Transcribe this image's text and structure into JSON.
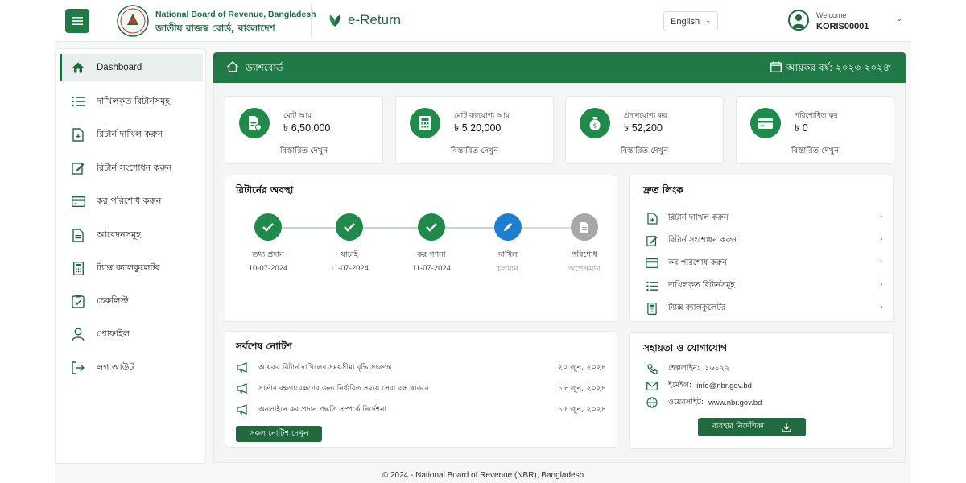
{
  "header": {
    "org_en": "National Board of Revenue, Bangladesh",
    "org_bn": "জাতীয় রাজস্ব বোর্ড, বাংলাদেশ",
    "app_title": "e-Return",
    "language": "English",
    "welcome": "Welcome",
    "username": "KORIS00001"
  },
  "sidebar": {
    "items": [
      {
        "label": "Dashboard",
        "icon": "home-icon"
      },
      {
        "label": "দাখিলকৃত রিটার্নসমূহ",
        "icon": "list-icon"
      },
      {
        "label": "রিটার্ন দাখিল করুন",
        "icon": "file-plus-icon"
      },
      {
        "label": "রিটার্ন সংশোধন করুন",
        "icon": "edit-icon"
      },
      {
        "label": "কর পরিশোধ করুন",
        "icon": "card-icon"
      },
      {
        "label": "আবেদনসমূহ",
        "icon": "document-icon"
      },
      {
        "label": "ট্যাক্স ক্যালকুলেটর",
        "icon": "calculator-icon"
      },
      {
        "label": "চেকলিস্ট",
        "icon": "checklist-icon"
      },
      {
        "label": "প্রোফাইল",
        "icon": "user-icon"
      },
      {
        "label": "লগ আউট",
        "icon": "logout-icon"
      }
    ]
  },
  "topbar": {
    "title": "ড্যাশবোর্ড",
    "fiscal_year": "আয়কর বর্ষ: ২০২৩-২০২৪"
  },
  "stats": [
    {
      "label": "মোট আয়",
      "value": "৳ 6,50,000",
      "link": "বিস্তারিত দেখুন",
      "icon": "income-doc-icon"
    },
    {
      "label": "মোট করযোগ্য আয়",
      "value": "৳ 5,20,000",
      "link": "বিস্তারিত দেখুন",
      "icon": "calculator-icon"
    },
    {
      "label": "প্রদানযোগ্য কর",
      "value": "৳ 52,200",
      "link": "বিস্তারিত দেখুন",
      "icon": "money-bag-icon"
    },
    {
      "label": "পরিশোধিত কর",
      "value": "৳ 0",
      "link": "বিস্তারিত দেখুন",
      "icon": "wallet-card-icon"
    }
  ],
  "return_status": {
    "title": "রিটার্নের অবস্থা",
    "steps": [
      {
        "label": "তথ্য প্রদান",
        "date": "10-07-2024",
        "state": "done"
      },
      {
        "label": "যাচাই",
        "date": "11-07-2024",
        "state": "done"
      },
      {
        "label": "কর গণনা",
        "date": "11-07-2024",
        "state": "done"
      },
      {
        "label": "দাখিল",
        "date": "চলমান",
        "state": "current"
      },
      {
        "label": "পরিশোধ",
        "date": "অপেক্ষমাণ",
        "state": "pending"
      }
    ]
  },
  "quick_links": {
    "title": "দ্রুত লিংক",
    "items": [
      {
        "label": "রিটার্ন দাখিল করুন",
        "icon": "file-plus-icon"
      },
      {
        "label": "রিটার্ন সংশোধন করুন",
        "icon": "edit-icon"
      },
      {
        "label": "কর পরিশোধ করুন",
        "icon": "card-icon"
      },
      {
        "label": "দাখিলকৃত রিটার্নসমূহ",
        "icon": "list-icon"
      },
      {
        "label": "ট্যাক্স ক্যালকুলেটর",
        "icon": "calculator-icon"
      }
    ]
  },
  "notices": {
    "title": "সর্বশেষ নোটিশ",
    "items": [
      {
        "text": "আয়কর রিটার্ন দাখিলের সময়সীমা বৃদ্ধি সংক্রান্ত",
        "date": "২০ জুন, ২০২৪"
      },
      {
        "text": "সার্ভার রক্ষণাবেক্ষণের জন্য নির্ধারিত সময়ে সেবা বন্ধ থাকবে",
        "date": "১৮ জুন, ২০২৪"
      },
      {
        "text": "অনলাইনে কর প্রদান পদ্ধতি সম্পর্কে নির্দেশনা",
        "date": "১৫ জুন, ২০২৪"
      }
    ],
    "button": "সকল নোটিশ দেখুন"
  },
  "help": {
    "title": "সহায়তা ও যোগাযোগ",
    "hotline_label": "হেল্পলাইন:",
    "hotline": "১৬১২২",
    "email_label": "ইমেইল:",
    "email": "info@nbr.gov.bd",
    "website_label": "ওয়েবসাইট:",
    "website": "www.nbr.gov.bd",
    "button": "ব্যবহার নির্দেশিকা"
  },
  "footer": "© 2024 - National Board of Revenue (NBR), Bangladesh",
  "colors": {
    "primary": "#1f7a45",
    "accent": "#1f8a49",
    "current": "#1e7fd1",
    "pending": "#a5a8a7"
  }
}
